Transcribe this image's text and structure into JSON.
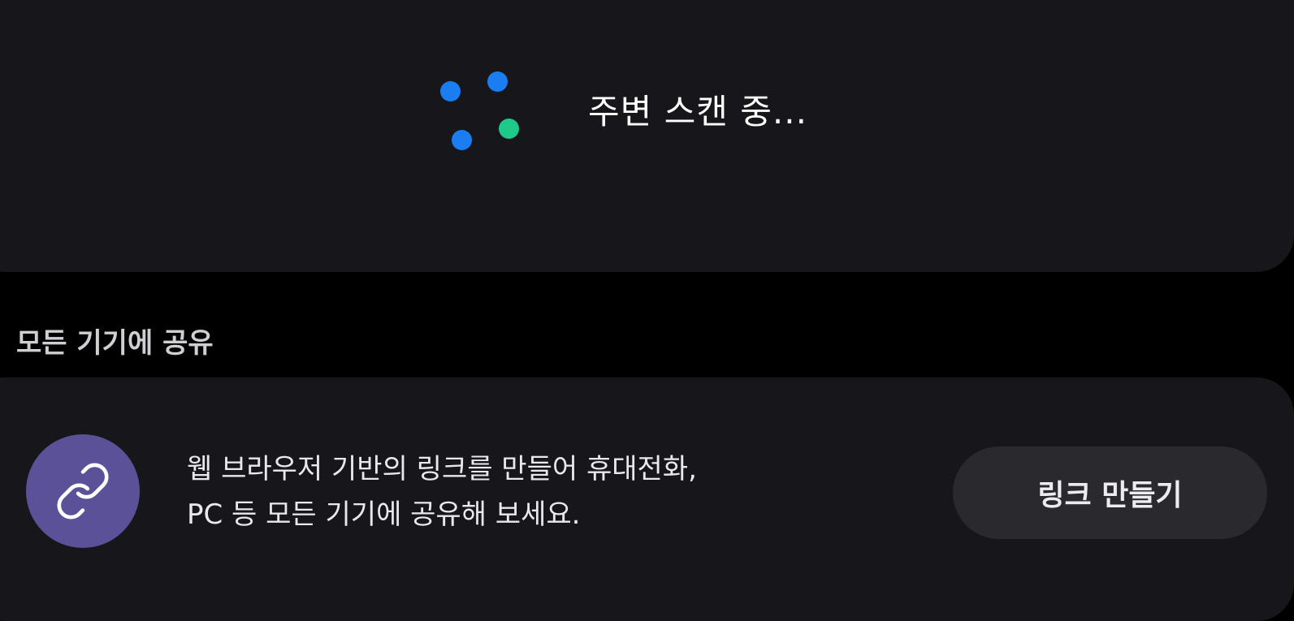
{
  "scan": {
    "status_text": "주변 스캔 중...",
    "dot_colors": [
      "#1a7ef2",
      "#1a7ef2",
      "#1a7ef2",
      "#1ec98a"
    ]
  },
  "share_all": {
    "section_title": "모든 기기에 공유",
    "icon": "link-icon",
    "icon_bg": "#5a5199",
    "description_line1": "웹 브라우저 기반의 링크를 만들어 휴대전화,",
    "description_line2": "PC 등 모든 기기에 공유해 보세요.",
    "button_label": "링크 만들기"
  }
}
